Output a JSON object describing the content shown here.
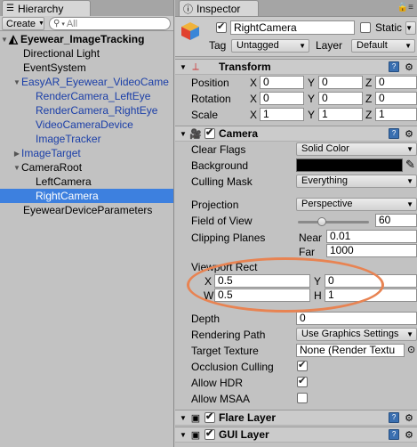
{
  "hierarchy": {
    "tab_label": "Hierarchy",
    "create_label": "Create",
    "search_placeholder": "All",
    "items": [
      {
        "label": "Eyewear_ImageTracking"
      },
      {
        "label": "Directional Light"
      },
      {
        "label": "EventSystem"
      },
      {
        "label": "EasyAR_Eyewear_VideoCame"
      },
      {
        "label": "RenderCamera_LeftEye"
      },
      {
        "label": "RenderCamera_RightEye"
      },
      {
        "label": "VideoCameraDevice"
      },
      {
        "label": "ImageTracker"
      },
      {
        "label": "ImageTarget"
      },
      {
        "label": "CameraRoot"
      },
      {
        "label": "LeftCamera"
      },
      {
        "label": "RightCamera"
      },
      {
        "label": "EyewearDeviceParameters"
      }
    ],
    "selected": "RightCamera"
  },
  "inspector": {
    "tab_label": "Inspector",
    "object_name": "RightCamera",
    "static_label": "Static",
    "tag_label": "Tag",
    "tag_value": "Untagged",
    "layer_label": "Layer",
    "layer_value": "Default",
    "transform": {
      "title": "Transform",
      "position_label": "Position",
      "rotation_label": "Rotation",
      "scale_label": "Scale",
      "x": "X",
      "y": "Y",
      "z": "Z",
      "position": [
        "0",
        "0",
        "0"
      ],
      "rotation": [
        "0",
        "0",
        "0"
      ],
      "scale": [
        "1",
        "1",
        "1"
      ]
    },
    "camera": {
      "title": "Camera",
      "clear_flags_label": "Clear Flags",
      "clear_flags_value": "Solid Color",
      "background_label": "Background",
      "background_color": "#000000",
      "culling_mask_label": "Culling Mask",
      "culling_mask_value": "Everything",
      "projection_label": "Projection",
      "projection_value": "Perspective",
      "fov_label": "Field of View",
      "fov_value": "60",
      "clipping_label": "Clipping Planes",
      "near_label": "Near",
      "near_value": "0.01",
      "far_label": "Far",
      "far_value": "1000",
      "viewport_label": "Viewport Rect",
      "vp_x_label": "X",
      "vp_x": "0.5",
      "vp_y_label": "Y",
      "vp_y": "0",
      "vp_w_label": "W",
      "vp_w": "0.5",
      "vp_h_label": "H",
      "vp_h": "1",
      "depth_label": "Depth",
      "depth_value": "0",
      "rendering_path_label": "Rendering Path",
      "rendering_path_value": "Use Graphics Settings",
      "target_texture_label": "Target Texture",
      "target_texture_value": "None (Render Textu",
      "occlusion_label": "Occlusion Culling",
      "hdr_label": "Allow HDR",
      "msaa_label": "Allow MSAA"
    },
    "flare_layer": "Flare Layer",
    "gui_layer": "GUI Layer"
  },
  "colors": {
    "selection": "#3d80df",
    "annotation": "#e88352",
    "link_blue": "#1a3ea8"
  }
}
